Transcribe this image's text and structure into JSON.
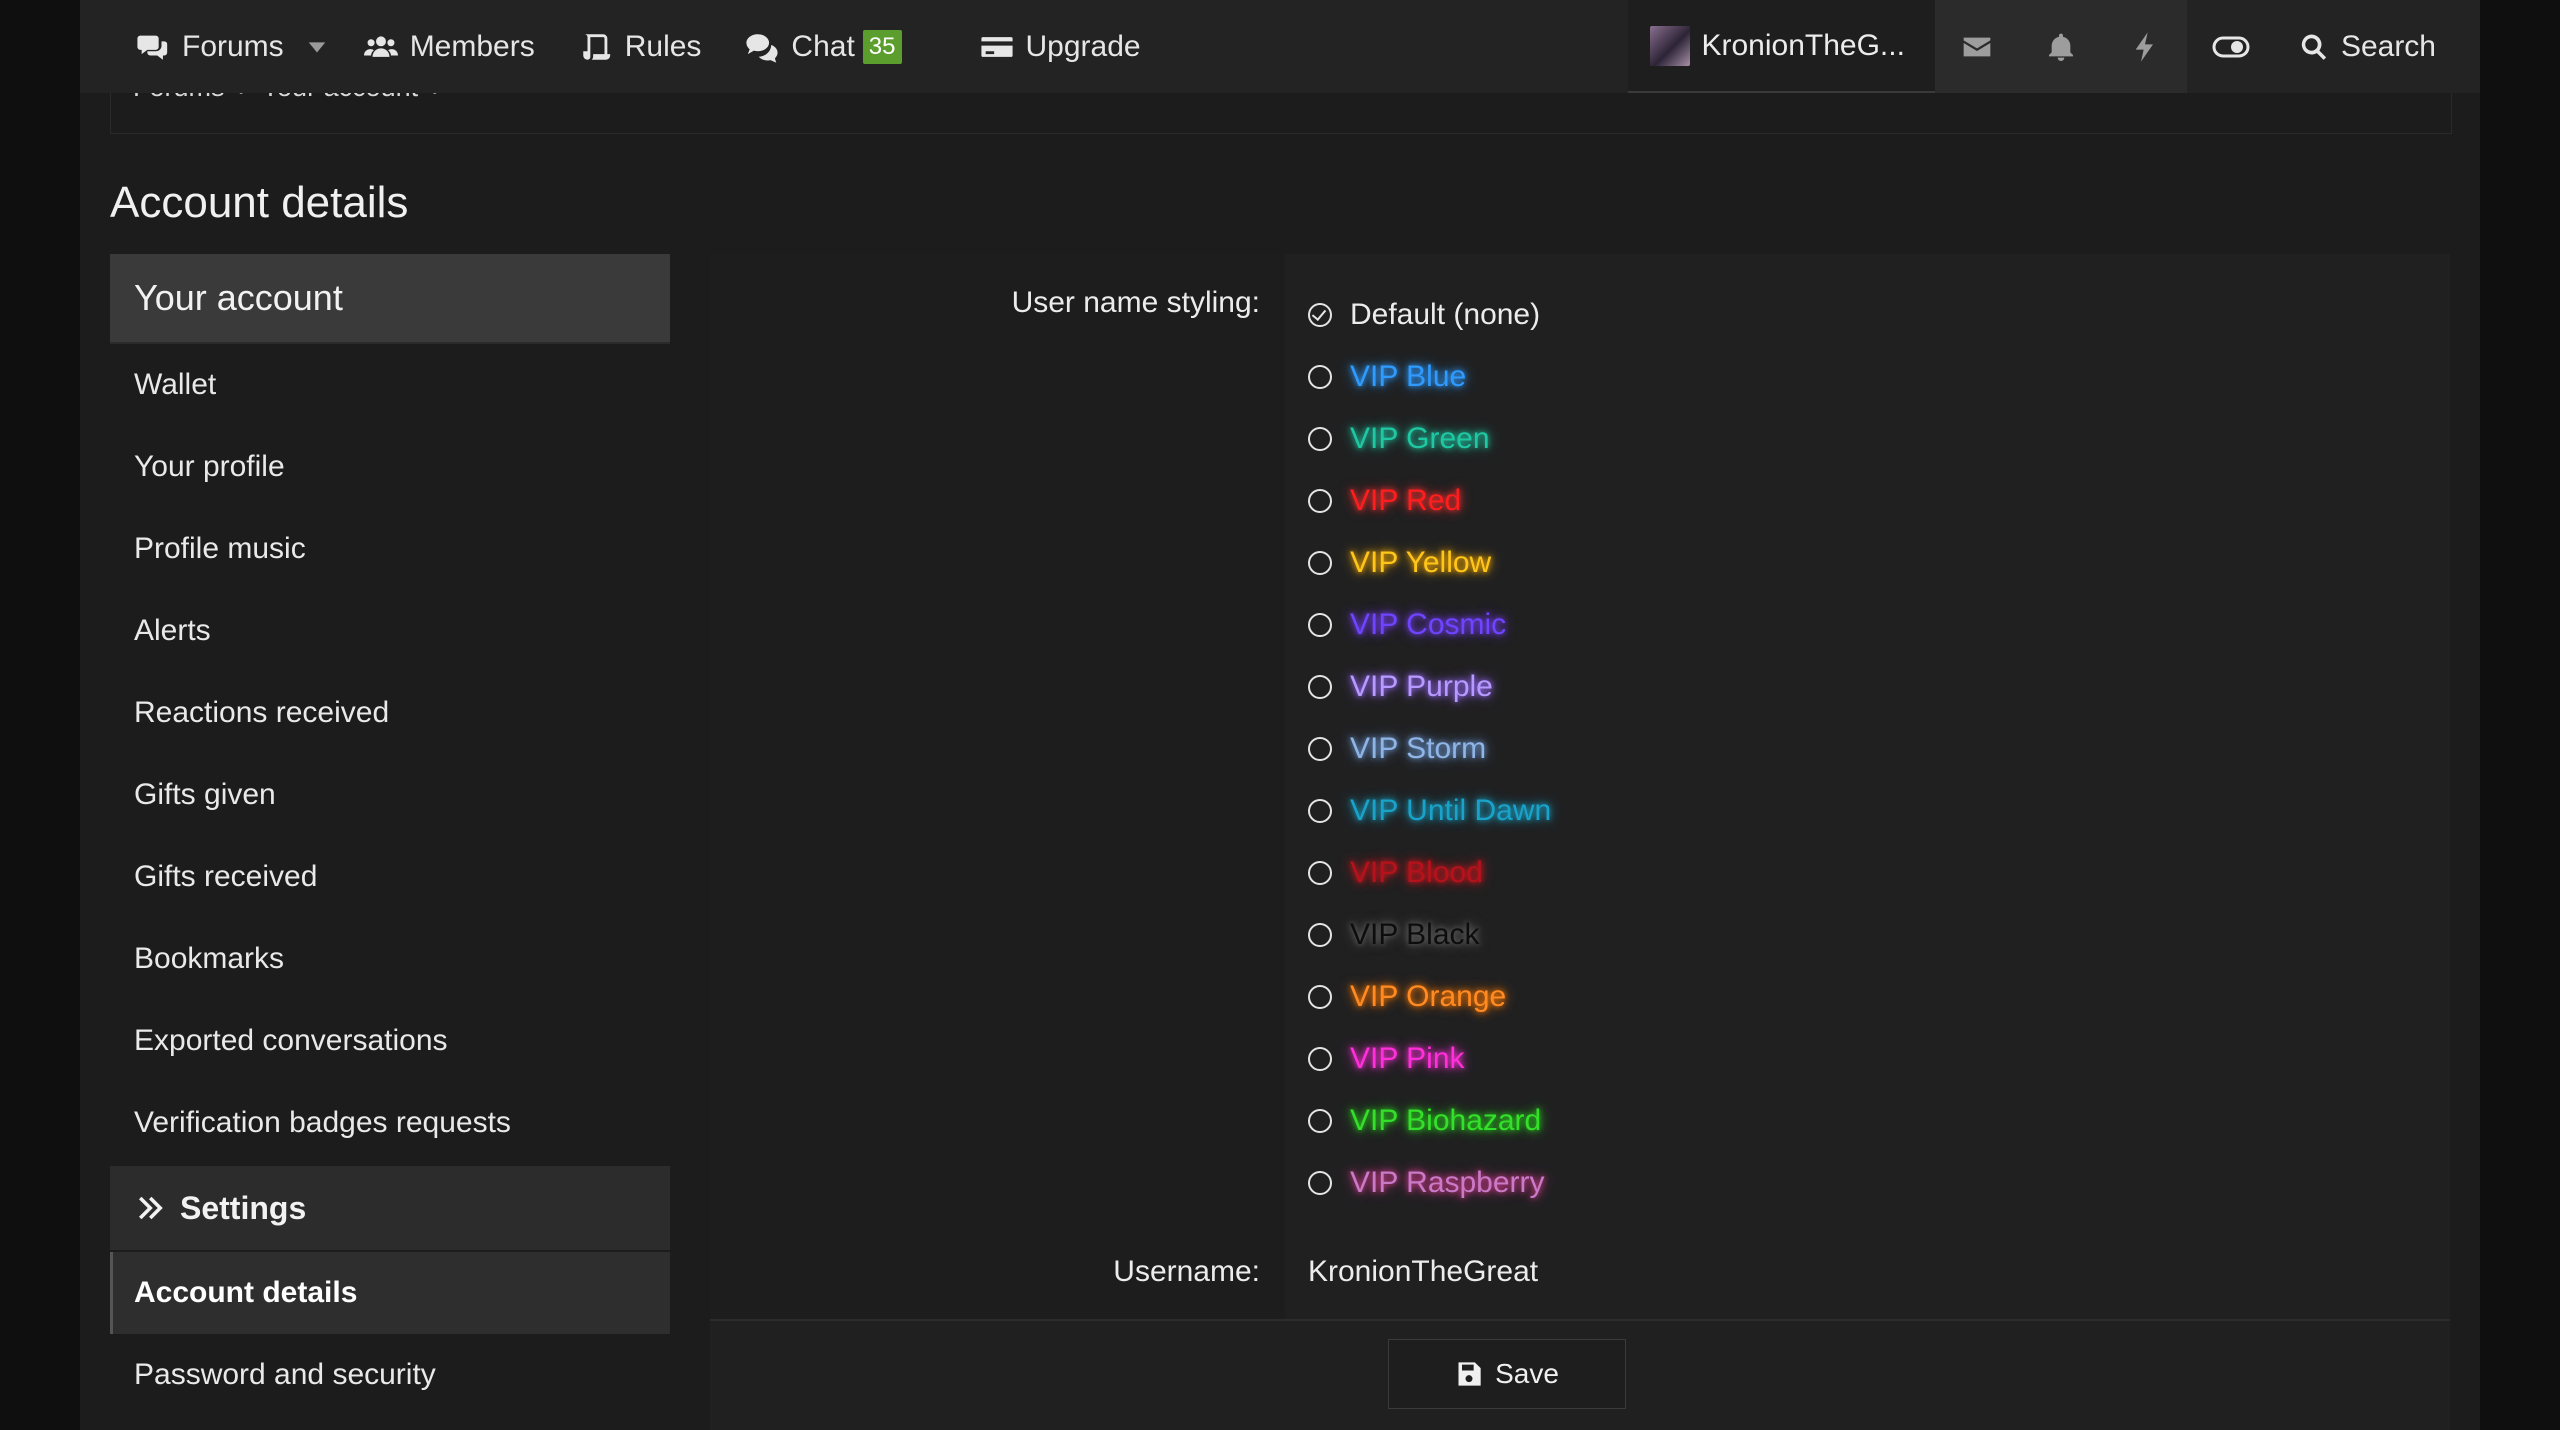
{
  "nav": {
    "forums": "Forums",
    "members": "Members",
    "rules": "Rules",
    "chat": "Chat",
    "chat_badge": "35",
    "upgrade": "Upgrade",
    "username": "KronionTheG...",
    "search": "Search"
  },
  "breadcrumb": [
    "Forums",
    "Your account"
  ],
  "page_title": "Account details",
  "sidebar": {
    "head": "Your account",
    "items": [
      "Wallet",
      "Your profile",
      "Profile music",
      "Alerts",
      "Reactions received",
      "Gifts given",
      "Gifts received",
      "Bookmarks",
      "Exported conversations",
      "Verification badges requests"
    ],
    "settings": "Settings",
    "active": "Account details",
    "after": [
      "Password and security"
    ]
  },
  "form": {
    "styling_label": "User name styling:",
    "options": [
      {
        "label": "Default (none)",
        "color": "#ececec",
        "glow": "",
        "checked": true
      },
      {
        "label": "VIP Blue",
        "color": "#2f9bff",
        "glow": "#2f9bff",
        "checked": false
      },
      {
        "label": "VIP Green",
        "color": "#1fc7a2",
        "glow": "#1fc7a2",
        "checked": false
      },
      {
        "label": "VIP Red",
        "color": "#ff1d1d",
        "glow": "#ff3030",
        "checked": false
      },
      {
        "label": "VIP Yellow",
        "color": "#ffc61a",
        "glow": "#ffb000",
        "checked": false
      },
      {
        "label": "VIP Cosmic",
        "color": "#6d45ff",
        "glow": "#7b3fff",
        "checked": false
      },
      {
        "label": "VIP Purple",
        "color": "#b79aff",
        "glow": "#9b6bff",
        "checked": false
      },
      {
        "label": "VIP Storm",
        "color": "#8fb4e6",
        "glow": "#6f9bd6",
        "checked": false
      },
      {
        "label": "VIP Until Dawn",
        "color": "#1aa3c9",
        "glow": "#1aa3c9",
        "checked": false
      },
      {
        "label": "VIP Blood",
        "color": "#b5121b",
        "glow": "#e0161f",
        "checked": false
      },
      {
        "label": "VIP Black",
        "color": "#0d0d0d",
        "glow": "#6a6a6a",
        "checked": false
      },
      {
        "label": "VIP Orange",
        "color": "#ff8b22",
        "glow": "#ff7a00",
        "checked": false
      },
      {
        "label": "VIP Pink",
        "color": "#ff2fd9",
        "glow": "#ff2fd9",
        "checked": false
      },
      {
        "label": "VIP Biohazard",
        "color": "#35e02a",
        "glow": "#2ad41f",
        "checked": false
      },
      {
        "label": "VIP Raspberry",
        "color": "#c77ac6",
        "glow": "#d43a8e",
        "checked": false
      }
    ],
    "username_label": "Username:",
    "username_value": "KronionTheGreat",
    "save": "Save"
  }
}
